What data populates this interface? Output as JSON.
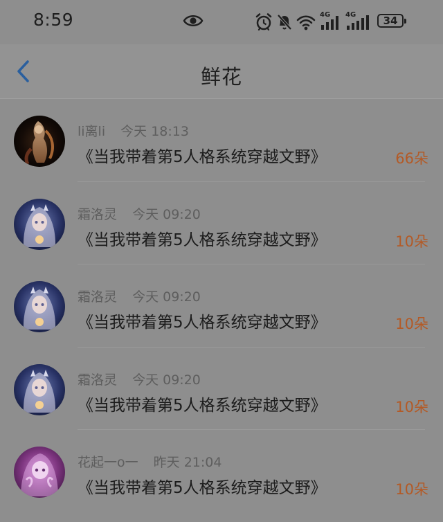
{
  "status_bar": {
    "time": "8:59",
    "network_1": "4G",
    "network_2": "4G",
    "battery": "34",
    "icons": [
      "eye-icon",
      "alarm-icon",
      "mute-icon",
      "wifi-icon",
      "signal-icon",
      "signal-icon",
      "battery-icon"
    ]
  },
  "header": {
    "title": "鲜花",
    "back_icon": "chevron-left-icon"
  },
  "colors": {
    "background": "#8e8e8e",
    "accent_count": "#b35a26",
    "back_icon": "#2a5f9e"
  },
  "records": [
    {
      "name": "li离li",
      "time": "今天 18:13",
      "book": "《当我带着第5人格系统穿越文野》",
      "count": "66朵",
      "avatar": "dark-phoenix-avatar"
    },
    {
      "name": "霜洛灵",
      "time": "今天 09:20",
      "book": "《当我带着第5人格系统穿越文野》",
      "count": "10朵",
      "avatar": "anime-girl-avatar"
    },
    {
      "name": "霜洛灵",
      "time": "今天 09:20",
      "book": "《当我带着第5人格系统穿越文野》",
      "count": "10朵",
      "avatar": "anime-girl-avatar"
    },
    {
      "name": "霜洛灵",
      "time": "今天 09:20",
      "book": "《当我带着第5人格系统穿越文野》",
      "count": "10朵",
      "avatar": "anime-girl-avatar"
    },
    {
      "name": "花起一o一",
      "time": "昨天 21:04",
      "book": "《当我带着第5人格系统穿越文野》",
      "count": "10朵",
      "avatar": "purple-anime-avatar"
    }
  ]
}
